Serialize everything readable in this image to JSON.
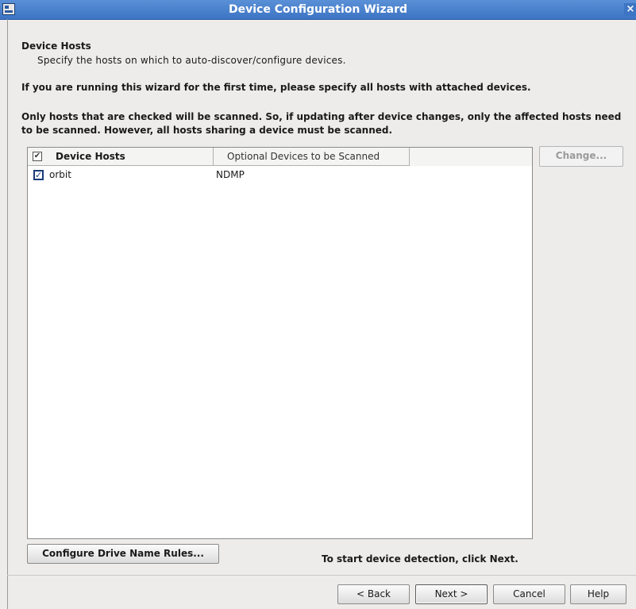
{
  "window": {
    "title": "Device Configuration Wizard",
    "close_glyph": "×"
  },
  "page": {
    "heading": "Device Hosts",
    "subheading": "Specify the hosts on which to auto-discover/configure devices.",
    "para1": "If you are running this wizard for the first time, please specify all hosts with attached devices.",
    "para2": "Only hosts that are checked will be scanned.  So, if updating after device changes, only the affected hosts need to be scanned.  However, all hosts sharing a device must be scanned."
  },
  "table": {
    "columns": [
      "Device Hosts",
      "Optional Devices to be Scanned"
    ],
    "header_checked": true,
    "rows": [
      {
        "checked": true,
        "host": "orbit",
        "devices": "NDMP"
      }
    ]
  },
  "buttons": {
    "change": "Change...",
    "configure_rules": "Configure Drive Name Rules...",
    "back": "< Back",
    "next": "Next >",
    "cancel": "Cancel",
    "help": "Help"
  },
  "hint": "To start device detection, click Next.",
  "colors": {
    "title_bar": "#3d74c4",
    "background": "#edeceb"
  },
  "icons": {
    "window": "app-window-icon",
    "close": "close-icon",
    "check": "checkmark-icon"
  }
}
